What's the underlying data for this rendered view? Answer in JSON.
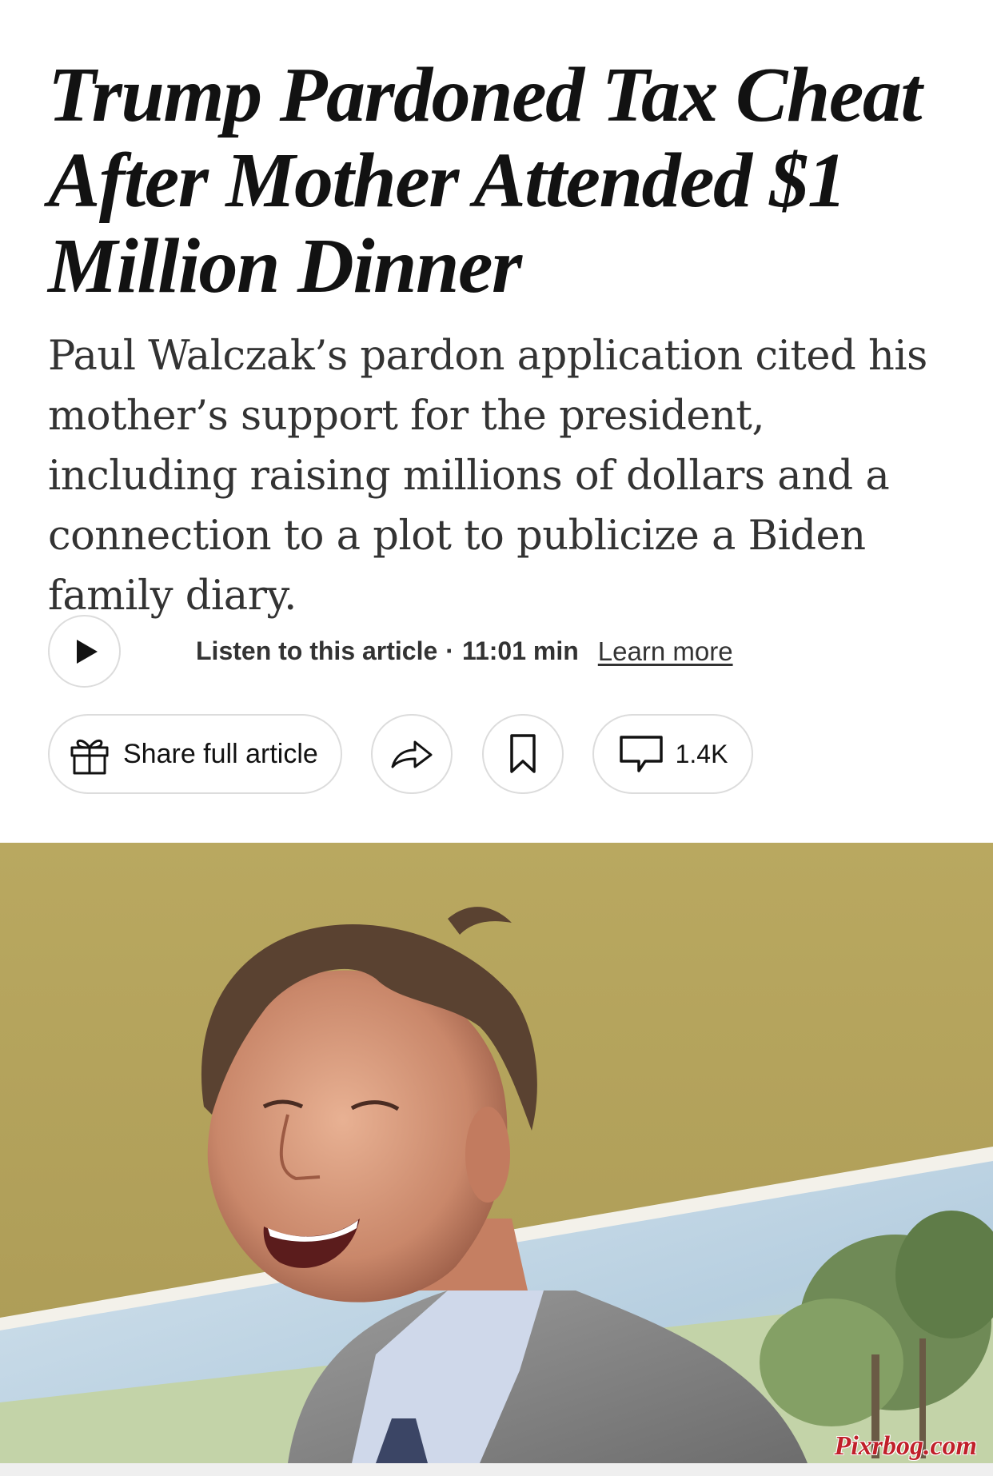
{
  "article": {
    "headline": "Trump Pardoned Tax Cheat After Mother Attended $1 Million Dinner",
    "summary": "Paul Walczak’s pardon application cited his mother’s support for the president, including raising millions of dollars and a connection to a plot to publicize a Biden family diary."
  },
  "audio": {
    "play_icon": "play-icon",
    "listen_label": "Listen to this article",
    "separator": "·",
    "duration": "11:01 min",
    "learn_more": "Learn more"
  },
  "actions": {
    "share_full_label": "Share full article",
    "gift_icon": "gift-icon",
    "share_icon": "share-arrow-icon",
    "save_icon": "bookmark-icon",
    "comment_icon": "comment-icon",
    "comment_count": "1.4K"
  },
  "photo": {
    "watermark": "Pixrbog.com"
  },
  "colors": {
    "text": "#121212",
    "summary_text": "#333333",
    "border": "#dcdcdc",
    "wall": "#b6a35e"
  }
}
